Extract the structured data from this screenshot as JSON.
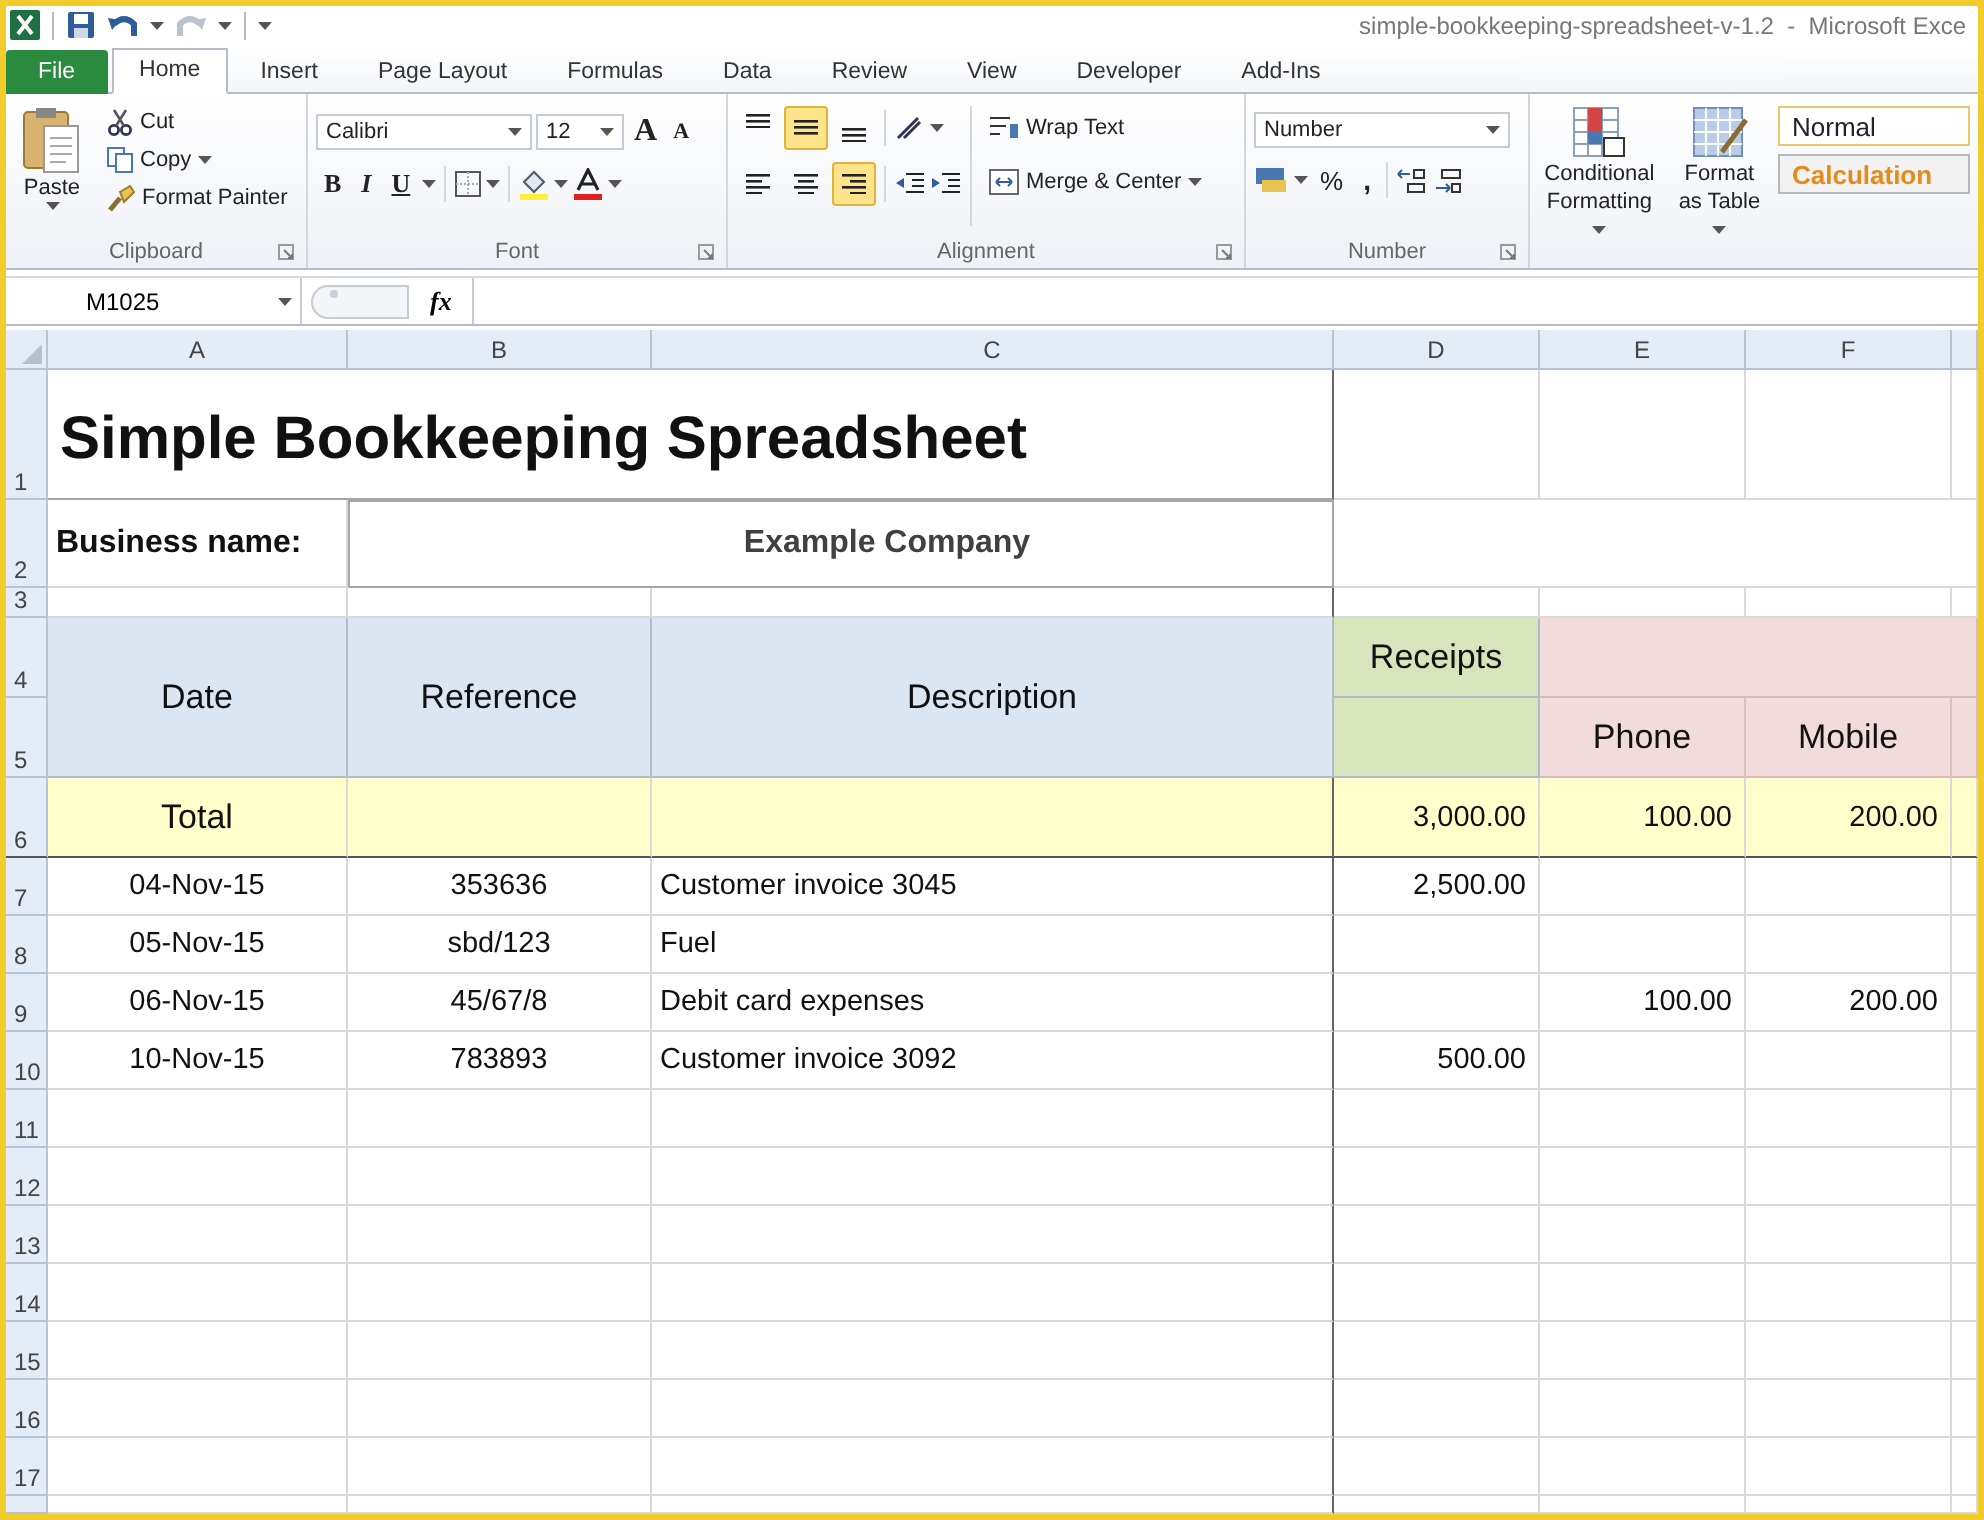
{
  "window": {
    "title": "simple-bookkeeping-spreadsheet-v-1.2  -  Microsoft Exce"
  },
  "quick_access": [
    {
      "kind": "save",
      "disabled": false
    },
    {
      "kind": "undo",
      "disabled": false
    },
    {
      "kind": "redo",
      "disabled": true
    }
  ],
  "tabs": [
    {
      "label": "File",
      "kind": "file",
      "selected": false
    },
    {
      "label": "Home",
      "kind": "tab",
      "selected": true
    },
    {
      "label": "Insert",
      "kind": "tab",
      "selected": false
    },
    {
      "label": "Page Layout",
      "kind": "tab",
      "selected": false
    },
    {
      "label": "Formulas",
      "kind": "tab",
      "selected": false
    },
    {
      "label": "Data",
      "kind": "tab",
      "selected": false
    },
    {
      "label": "Review",
      "kind": "tab",
      "selected": false
    },
    {
      "label": "View",
      "kind": "tab",
      "selected": false
    },
    {
      "label": "Developer",
      "kind": "tab",
      "selected": false
    },
    {
      "label": "Add-Ins",
      "kind": "tab",
      "selected": false
    }
  ],
  "ribbon": {
    "clipboard": {
      "label": "Clipboard",
      "paste": "Paste",
      "cut": "Cut",
      "copy": "Copy",
      "format_painter": "Format Painter"
    },
    "font": {
      "label": "Font",
      "font_name": "Calibri",
      "font_size": "12",
      "grow": "A",
      "shrink": "A",
      "bold": "B",
      "italic": "I",
      "underline": "U"
    },
    "alignment": {
      "label": "Alignment",
      "vertical": [
        {
          "kind": "top",
          "selected": false
        },
        {
          "kind": "middle",
          "selected": true
        },
        {
          "kind": "bottom",
          "selected": false
        }
      ],
      "horizontal": [
        {
          "kind": "left",
          "selected": false
        },
        {
          "kind": "center",
          "selected": false
        },
        {
          "kind": "right",
          "selected": true
        }
      ],
      "wrap_text": "Wrap Text",
      "merge": "Merge & Center"
    },
    "number": {
      "label": "Number",
      "format": "Number",
      "percent": "%",
      "comma": ","
    },
    "styles": {
      "conditional": [
        "Conditional",
        "Formatting"
      ],
      "format_table": [
        "Format",
        "as Table"
      ],
      "cell_styles": [
        {
          "label": "Normal",
          "kind": "normal"
        },
        {
          "label": "Calculation",
          "kind": "calculation"
        }
      ]
    }
  },
  "formula_bar": {
    "name_box": "M1025",
    "function_label": "fx"
  },
  "sheet": {
    "column_headers": [
      "A",
      "B",
      "C",
      "D",
      "E",
      "F"
    ],
    "row_headers": [
      "1",
      "2",
      "3",
      "4",
      "5",
      "6",
      "7",
      "8",
      "9",
      "10",
      "11",
      "12",
      "13",
      "14",
      "15",
      "16",
      "17"
    ],
    "title": "Simple Bookkeeping Spreadsheet",
    "business_label": "Business name:",
    "business_name": "Example Company",
    "header_labels": [
      "Date",
      "Reference",
      "Description",
      "Receipts"
    ],
    "expense_columns": [
      "Phone",
      "Mobile"
    ],
    "total_row": {
      "label": "Total",
      "receipts": "3,000.00",
      "expenses": [
        "100.00",
        "200.00"
      ]
    },
    "entries": [
      {
        "date": "04-Nov-15",
        "reference": "353636",
        "description": "Customer invoice 3045",
        "receipts": "2,500.00"
      },
      {
        "date": "05-Nov-15",
        "reference": "sbd/123",
        "description": "Fuel"
      },
      {
        "date": "06-Nov-15",
        "reference": "45/67/8",
        "description": "Debit card expenses",
        "expenses": [
          "100.00",
          "200.00"
        ]
      },
      {
        "date": "10-Nov-15",
        "reference": "783893",
        "description": "Customer invoice 3092",
        "receipts": "500.00"
      }
    ]
  }
}
